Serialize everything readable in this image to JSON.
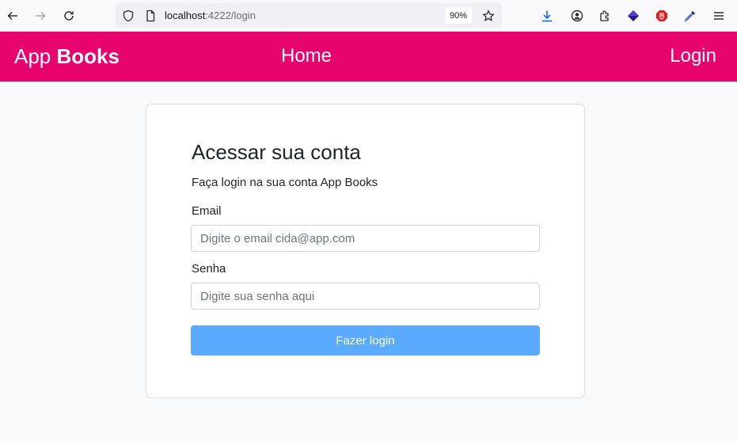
{
  "browser": {
    "url_host": "localhost",
    "url_rest": ":4222/login",
    "zoom": "90%",
    "icons": [
      "back-arrow-icon",
      "forward-arrow-icon",
      "reload-icon",
      "shield-icon",
      "page-icon",
      "star-icon",
      "download-icon",
      "account-icon",
      "extensions-icon",
      "extension-diamond-icon",
      "extension-shield-icon",
      "eyedropper-icon",
      "menu-icon"
    ]
  },
  "navbar": {
    "brand_light": "App",
    "brand_bold": "Books",
    "home_label": "Home",
    "login_label": "Login",
    "color": "#e8046e"
  },
  "card": {
    "title": "Acessar sua conta",
    "subtitle": "Faça login na sua conta App Books",
    "email_label": "Email",
    "email_placeholder": "Digite o email cida@app.com",
    "email_value": "",
    "senha_label": "Senha",
    "senha_placeholder": "Digite sua senha aqui",
    "senha_value": "",
    "button_label": "Fazer login",
    "button_color": "#5aabff"
  }
}
